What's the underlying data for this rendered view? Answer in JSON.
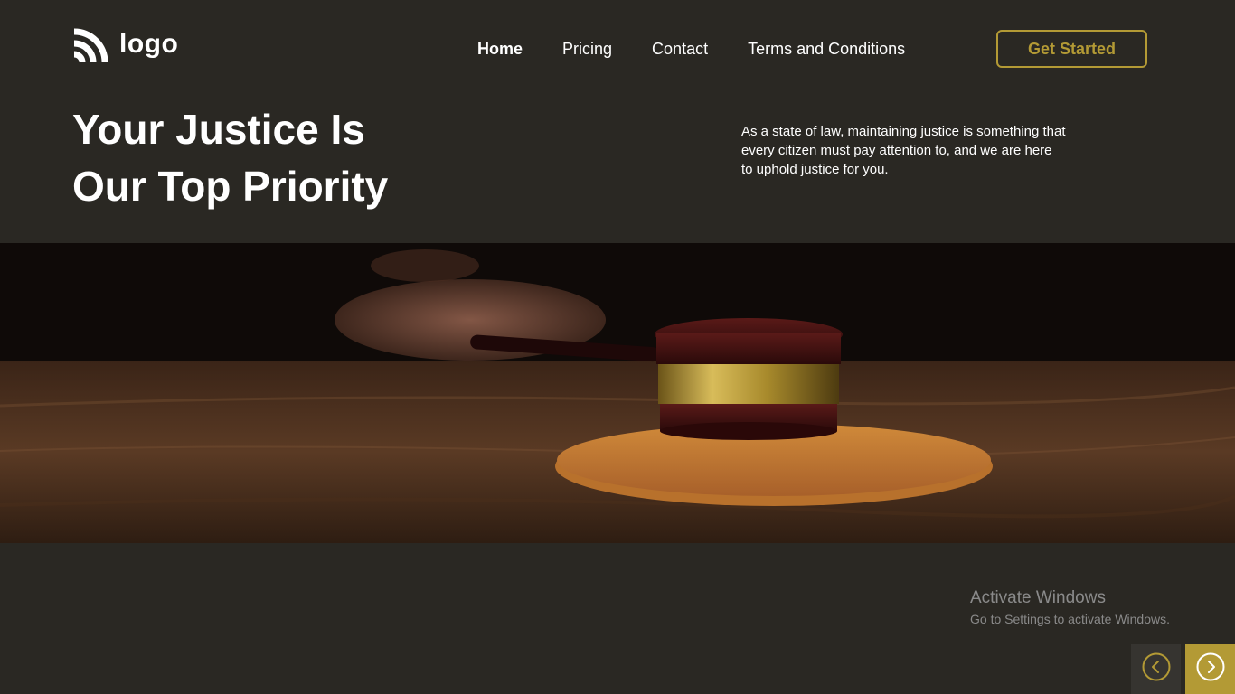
{
  "brand": {
    "logo_text": "logo"
  },
  "nav": {
    "items": [
      {
        "label": "Home",
        "active": true
      },
      {
        "label": "Pricing",
        "active": false
      },
      {
        "label": "Contact",
        "active": false
      },
      {
        "label": "Terms and Conditions",
        "active": false
      }
    ],
    "cta_label": "Get Started"
  },
  "hero": {
    "title_line1": "Your Justice Is",
    "title_line2": "Our Top Priority",
    "description": "As a state of law, maintaining justice is something that every citizen must pay attention to, and we are here to uphold justice for you.",
    "image_subject": "judge-gavel-on-sound-block"
  },
  "watermark": {
    "title": "Activate Windows",
    "subtitle": "Go to Settings to activate Windows."
  },
  "slider": {
    "prev_icon": "chevron-left-icon",
    "next_icon": "chevron-right-icon"
  },
  "colors": {
    "background": "#2a2823",
    "accent": "#b39a35",
    "text": "#ffffff",
    "prev_button_bg": "#363430"
  }
}
